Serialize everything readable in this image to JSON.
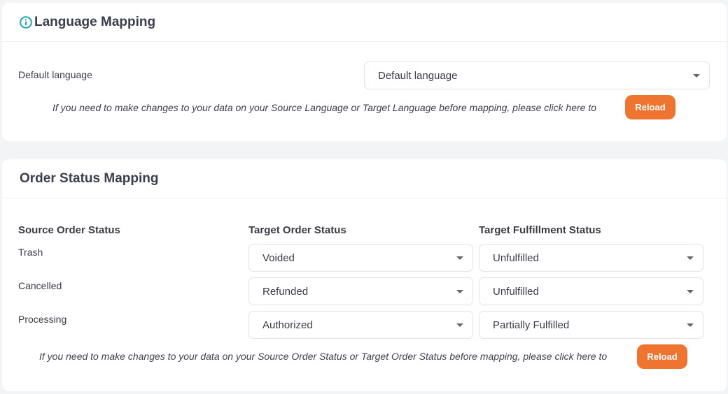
{
  "language_mapping": {
    "title": "Language Mapping",
    "icon": "info-icon",
    "default_language_label": "Default language",
    "default_language_select": "Default language",
    "note": "If you need to make changes to your data on your Source Language or Target Language before mapping, please click here to",
    "reload_label": "Reload"
  },
  "order_status_mapping": {
    "title": "Order Status Mapping",
    "columns": [
      "Source Order Status",
      "Target Order Status",
      "Target Fulfillment Status"
    ],
    "rows": [
      {
        "source": "Trash",
        "target_order": "Voided",
        "target_fulfillment": "Unfulfilled"
      },
      {
        "source": "Cancelled",
        "target_order": "Refunded",
        "target_fulfillment": "Unfulfilled"
      },
      {
        "source": "Processing",
        "target_order": "Authorized",
        "target_fulfillment": "Partially Fulfilled"
      }
    ],
    "note": "If you need to make changes to your data on your Source Order Status or Target Order Status before mapping, please click here to",
    "reload_label": "Reload"
  },
  "colors": {
    "accent": "#ef7430",
    "info_icon": "#1fa3b8",
    "background": "#f3f4f6"
  }
}
